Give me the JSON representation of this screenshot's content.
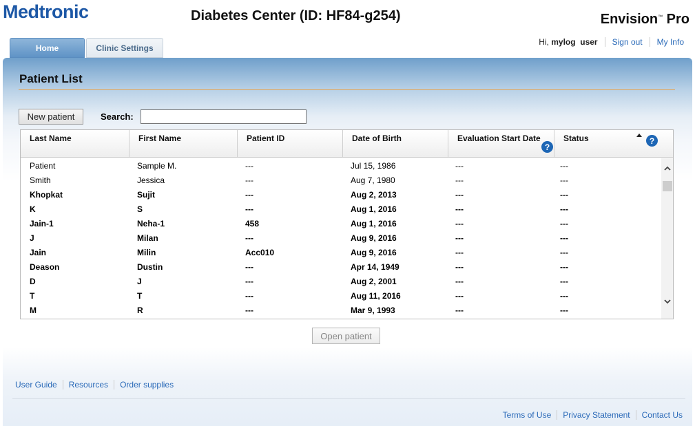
{
  "header": {
    "logo_text": "Medtronic",
    "center_title": "Diabetes Center (ID: HF84-g254)",
    "product": "Envision",
    "product_tm": "™",
    "product_suffix": " Pro"
  },
  "userbar": {
    "greeting": "Hi,",
    "first": "mylog",
    "last": "user",
    "sign_out": "Sign out",
    "my_info": "My Info"
  },
  "tabs": [
    {
      "label": "Home",
      "active": true
    },
    {
      "label": "Clinic Settings",
      "active": false
    }
  ],
  "main": {
    "title": "Patient List",
    "new_patient": "New patient",
    "search_label": "Search:",
    "search_value": "",
    "open_patient": "Open patient"
  },
  "table": {
    "columns": [
      "Last Name",
      "First Name",
      "Patient ID",
      "Date of Birth",
      "Evaluation Start Date",
      "Status"
    ],
    "help_icon": "?",
    "rows": [
      {
        "last": "Patient",
        "first": "Sample M.",
        "pid": "---",
        "dob": "Jul 15, 1986",
        "eval": "---",
        "status": "---",
        "bold": false
      },
      {
        "last": "Smith",
        "first": "Jessica",
        "pid": "---",
        "dob": "Aug 7, 1980",
        "eval": "---",
        "status": "---",
        "bold": false
      },
      {
        "last": "Khopkat",
        "first": "Sujit",
        "pid": "---",
        "dob": "Aug 2, 2013",
        "eval": "---",
        "status": "---",
        "bold": true
      },
      {
        "last": "K",
        "first": "S",
        "pid": "---",
        "dob": "Aug 1, 2016",
        "eval": "---",
        "status": "---",
        "bold": true
      },
      {
        "last": "Jain-1",
        "first": "Neha-1",
        "pid": "458",
        "dob": "Aug 1, 2016",
        "eval": "---",
        "status": "---",
        "bold": true
      },
      {
        "last": "J",
        "first": "Milan",
        "pid": "---",
        "dob": "Aug 9, 2016",
        "eval": "---",
        "status": "---",
        "bold": true
      },
      {
        "last": "Jain",
        "first": "Milin",
        "pid": "Acc010",
        "dob": "Aug 9, 2016",
        "eval": "---",
        "status": "---",
        "bold": true
      },
      {
        "last": "Deason",
        "first": "Dustin",
        "pid": "---",
        "dob": "Apr 14, 1949",
        "eval": "---",
        "status": "---",
        "bold": true
      },
      {
        "last": "D",
        "first": "J",
        "pid": "---",
        "dob": "Aug 2, 2001",
        "eval": "---",
        "status": "---",
        "bold": true
      },
      {
        "last": "T",
        "first": "T",
        "pid": "---",
        "dob": "Aug 11, 2016",
        "eval": "---",
        "status": "---",
        "bold": true
      },
      {
        "last": "M",
        "first": "R",
        "pid": "---",
        "dob": "Mar 9, 1993",
        "eval": "---",
        "status": "---",
        "bold": true
      }
    ]
  },
  "bottom_links": [
    "User Guide",
    "Resources",
    "Order supplies"
  ],
  "footer_links": [
    "Terms of Use",
    "Privacy Statement",
    "Contact Us"
  ],
  "colors": {
    "brand": "#1d58a6",
    "link": "#2a6ab8",
    "accent_rule": "#e7a24b",
    "help": "#1d66b5"
  }
}
